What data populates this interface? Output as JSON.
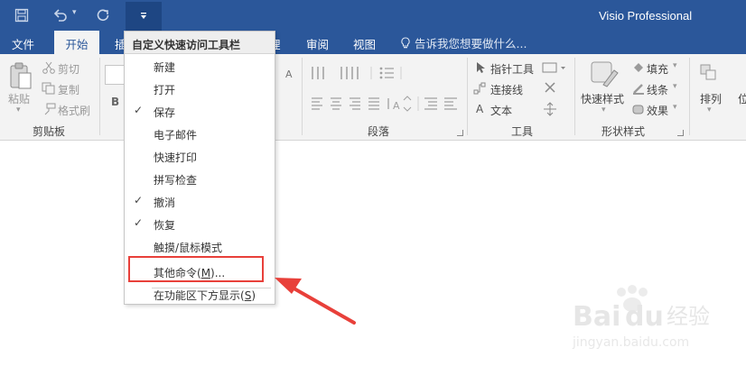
{
  "window": {
    "app_title": "Visio Professional"
  },
  "qat": {
    "save_icon": "save-icon",
    "undo_icon": "undo-icon",
    "redo_icon": "redo-icon",
    "customize_icon": "customize-dropdown-icon"
  },
  "tabs": {
    "file": "文件",
    "home": "开始",
    "insert_partial": "插",
    "partial_right": "理",
    "review": "审阅",
    "view": "视图",
    "tell_me": "告诉我您想要做什么..."
  },
  "ribbon": {
    "clipboard": {
      "label": "剪贴板",
      "paste": "粘贴",
      "cut": "剪切",
      "copy": "复制",
      "format_painter": "格式刷"
    },
    "font": {
      "bold_glyph": "B",
      "grow_glyph": "A"
    },
    "paragraph": {
      "label": "段落"
    },
    "tools": {
      "label": "工具",
      "pointer": "指针工具",
      "connector": "连接线",
      "text": "文本"
    },
    "shape_styles": {
      "label": "形状样式",
      "quick_styles": "快速样式",
      "fill": "填充",
      "line": "线条",
      "effects": "效果"
    },
    "arrange": {
      "label": "排列",
      "partial": "位"
    }
  },
  "menu": {
    "header": "自定义快速访问工具栏",
    "items": [
      {
        "label": "新建",
        "checked": false
      },
      {
        "label": "打开",
        "checked": false
      },
      {
        "label": "保存",
        "checked": true
      },
      {
        "label": "电子邮件",
        "checked": false
      },
      {
        "label": "快速打印",
        "checked": false
      },
      {
        "label": "拼写检查",
        "checked": false
      },
      {
        "label": "撤消",
        "checked": true
      },
      {
        "label": "恢复",
        "checked": true
      },
      {
        "label": "触摸/鼠标模式",
        "checked": false
      }
    ],
    "more_commands": {
      "prefix": "其他命令(",
      "key": "M",
      "suffix": ")..."
    },
    "show_below": {
      "prefix": "在功能区下方显示(",
      "key": "S",
      "suffix": ")"
    },
    "check_glyph": "✓"
  },
  "annotation": {
    "highlight_color": "#e8403a"
  },
  "watermark": {
    "brand": "Bai",
    "brand2": "du",
    "brand_cn": "经验",
    "url": "jingyan.baidu.com"
  },
  "colors": {
    "titlebar": "#2b579a",
    "ribbon": "#f3f3f3"
  }
}
